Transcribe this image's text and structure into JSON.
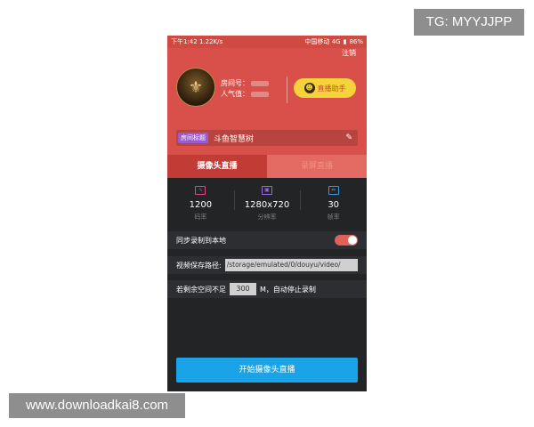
{
  "watermarks": {
    "tg": "TG: MYYJJPP",
    "site": "www.downloadkai8.com"
  },
  "statusbar": {
    "time": "下午1:42",
    "speed": "1.22K/s",
    "carrier": "中国移动 4G",
    "battery": "86%"
  },
  "header": {
    "logout": "注销",
    "room_no_label": "房间号：",
    "popularity_label": "人气值：",
    "assistant_label": "直播助手",
    "title_label": "房间标题",
    "title_value": "斗鱼智慧树"
  },
  "tabs": [
    {
      "label": "摄像头直播",
      "active": true
    },
    {
      "label": "录屏直播",
      "active": false
    }
  ],
  "stats": [
    {
      "value": "1200",
      "label": "码率",
      "icon": "bitrate-icon",
      "color": "#e04a8a"
    },
    {
      "value": "1280x720",
      "label": "分辨率",
      "icon": "resolution-icon",
      "color": "#9a6ae0"
    },
    {
      "value": "30",
      "label": "帧率",
      "icon": "framerate-icon",
      "color": "#3a9ae0"
    }
  ],
  "settings": {
    "sync_label": "同步录制到本地",
    "sync_on": true,
    "path_label": "视频保存路径:",
    "path_value": "/storage/emulated/0/douyu/video/",
    "space_prefix": "若剩余空间不足",
    "space_value": "300",
    "space_suffix": "M，自动停止录制"
  },
  "start_button": "开始摄像头直播",
  "colors": {
    "header_red": "#d9504a",
    "tab_active": "#c23c36",
    "assistant_yellow": "#f4d43a",
    "start_blue": "#1ba3e8",
    "dark_bg": "#222426"
  }
}
